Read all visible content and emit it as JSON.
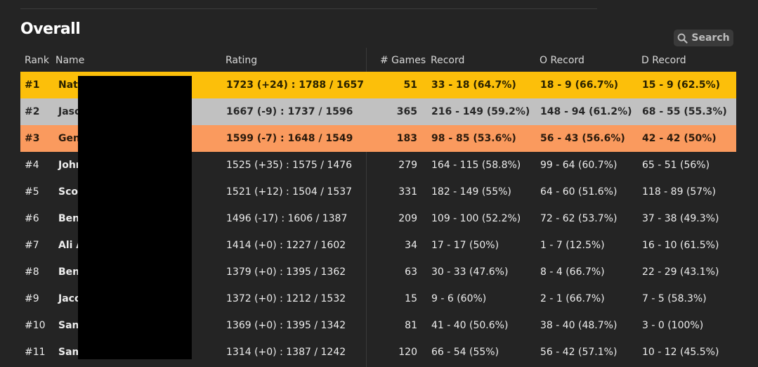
{
  "page": {
    "title": "Overall",
    "search_label": "Search"
  },
  "columns": {
    "rank": "Rank",
    "name": "Name",
    "rating": "Rating",
    "games": "# Games",
    "record": "Record",
    "o_record": "O Record",
    "d_record": "D Record"
  },
  "colors": {
    "gold": "#fcbf0a",
    "silver": "#c1c1c1",
    "bronze": "#fa9a5e",
    "background": "#242424"
  },
  "rows": [
    {
      "rank": "#1",
      "name": "Nate",
      "rating": "1723 (+24) : 1788 / 1657",
      "games": "51",
      "record": "33 - 18 (64.7%)",
      "o_record": "18 - 9 (66.7%)",
      "d_record": "15 - 9 (62.5%)"
    },
    {
      "rank": "#2",
      "name": "Jaso",
      "rating": "1667 (-9) : 1737 / 1596",
      "games": "365",
      "record": "216 - 149 (59.2%)",
      "o_record": "148 - 94 (61.2%)",
      "d_record": "68 - 55 (55.3%)"
    },
    {
      "rank": "#3",
      "name": "Gen",
      "rating": "1599 (-7) : 1648 / 1549",
      "games": "183",
      "record": "98 - 85 (53.6%)",
      "o_record": "56 - 43 (56.6%)",
      "d_record": "42 - 42 (50%)"
    },
    {
      "rank": "#4",
      "name": "John",
      "rating": "1525 (+35) : 1575 / 1476",
      "games": "279",
      "record": "164 - 115 (58.8%)",
      "o_record": "99 - 64 (60.7%)",
      "d_record": "65 - 51 (56%)"
    },
    {
      "rank": "#5",
      "name": "Scot",
      "rating": "1521 (+12) : 1504 / 1537",
      "games": "331",
      "record": "182 - 149 (55%)",
      "o_record": "64 - 60 (51.6%)",
      "d_record": "118 - 89 (57%)"
    },
    {
      "rank": "#6",
      "name": "Ben",
      "rating": "1496 (-17) : 1606 / 1387",
      "games": "209",
      "record": "109 - 100 (52.2%)",
      "o_record": "72 - 62 (53.7%)",
      "d_record": "37 - 38 (49.3%)"
    },
    {
      "rank": "#7",
      "name": "Ali A",
      "rating": "1414 (+0) : 1227 / 1602",
      "games": "34",
      "record": "17 - 17 (50%)",
      "o_record": "1 - 7 (12.5%)",
      "d_record": "16 - 10 (61.5%)"
    },
    {
      "rank": "#8",
      "name": "Ben",
      "rating": "1379 (+0) : 1395 / 1362",
      "games": "63",
      "record": "30 - 33 (47.6%)",
      "o_record": "8 - 4 (66.7%)",
      "d_record": "22 - 29 (43.1%)"
    },
    {
      "rank": "#9",
      "name": "Jaco",
      "rating": "1372 (+0) : 1212 / 1532",
      "games": "15",
      "record": "9 - 6 (60%)",
      "o_record": "2 - 1 (66.7%)",
      "d_record": "7 - 5 (58.3%)"
    },
    {
      "rank": "#10",
      "name": "San",
      "rating": "1369 (+0) : 1395 / 1342",
      "games": "81",
      "record": "41 - 40 (50.6%)",
      "o_record": "38 - 40 (48.7%)",
      "d_record": "3 - 0 (100%)"
    },
    {
      "rank": "#11",
      "name": "Sam",
      "rating": "1314 (+0) : 1387 / 1242",
      "games": "120",
      "record": "66 - 54 (55%)",
      "o_record": "56 - 42 (57.1%)",
      "d_record": "10 - 12 (45.5%)"
    }
  ]
}
